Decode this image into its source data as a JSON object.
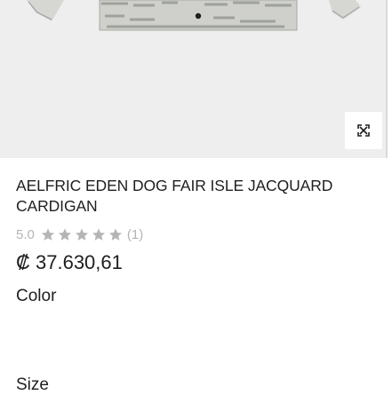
{
  "product": {
    "title": "AELFRIC EDEN DOG FAIR ISLE JACQUARD CARDIGAN",
    "rating": "5.0",
    "star_count": 5,
    "review_count": "(1)",
    "price": "₡ 37.630,61"
  },
  "options": {
    "color_label": "Color",
    "size_label": "Size"
  },
  "icons": {
    "expand": "expand-icon",
    "star": "star-icon"
  },
  "colors": {
    "star": "#b5b5b5",
    "image_background": "#eeeeee",
    "text": "#1f1f1f"
  }
}
